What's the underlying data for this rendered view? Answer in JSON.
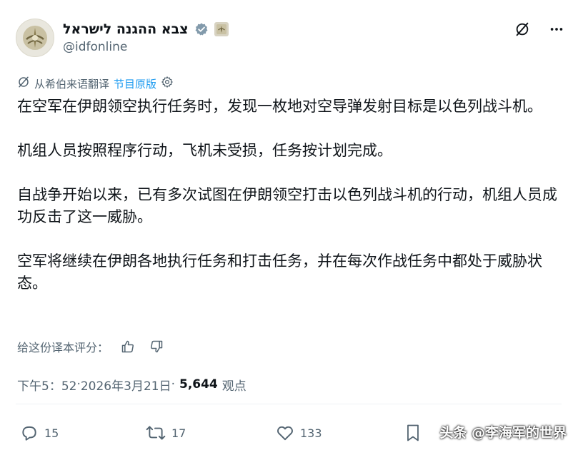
{
  "header": {
    "display_name": "צבא ההגנה לישראל",
    "handle": "@idfonline"
  },
  "translation": {
    "label": "从希伯来语翻译",
    "original_link": "节目原版"
  },
  "body": {
    "paragraphs": [
      "在空军在伊朗领空执行任务时，发现一枚地对空导弹发射目标是以色列战斗机。",
      "机组人员按照程序行动，飞机未受损，任务按计划完成。",
      "自战争开始以来，已有多次试图在伊朗领空打击以色列战斗机的行动，机组人员成功反击了这一威胁。",
      "空军将继续在伊朗各地执行任务和打击任务，并在每次作战任务中都处于威胁状态。"
    ]
  },
  "rating": {
    "label": "给这份译本评分："
  },
  "meta": {
    "time": "下午5：52",
    "separator": " · ",
    "date": "2026年3月21日",
    "views_count": "5,644",
    "views_label": "观点"
  },
  "actions": {
    "replies": "15",
    "reposts": "17",
    "likes": "133"
  },
  "watermark": "头条 @李海军的世界",
  "colors": {
    "link": "#1d9bf0",
    "secondary_text": "#536471",
    "primary_text": "#0f1419"
  },
  "icons": [
    "verified-badge-icon",
    "affiliation-badge-icon",
    "grok-icon",
    "more-icon",
    "translate-icon",
    "settings-icon",
    "thumbs-up-icon",
    "thumbs-down-icon",
    "reply-icon",
    "repost-icon",
    "like-icon",
    "bookmark-icon"
  ]
}
